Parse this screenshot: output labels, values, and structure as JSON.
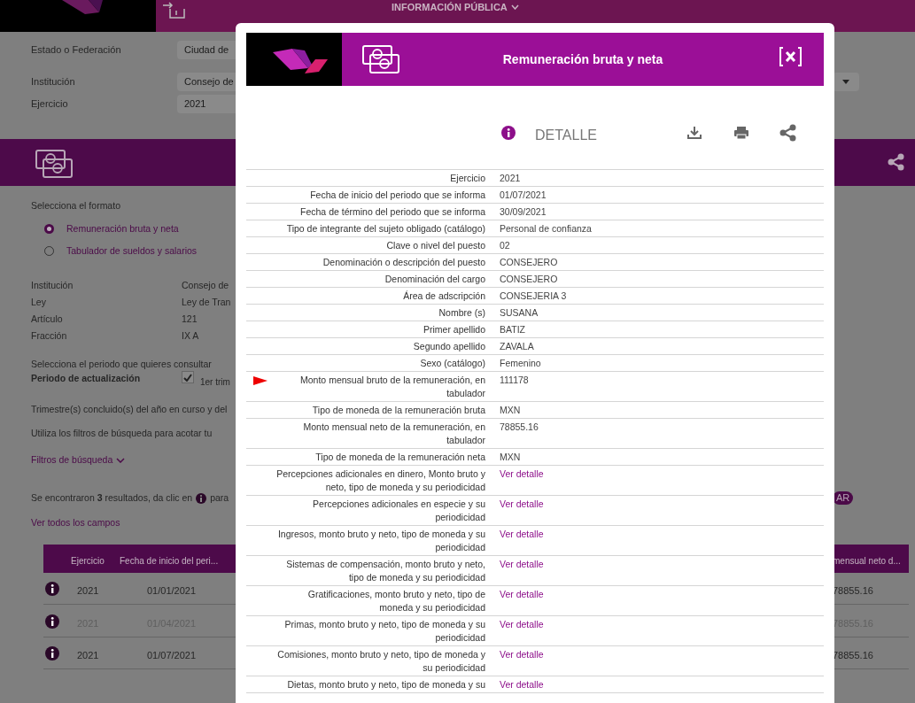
{
  "topbar": {
    "title": "INFORMACIÓN PÚBLICA"
  },
  "filters": [
    {
      "label": "Estado o Federación",
      "value": "Ciudad de"
    },
    {
      "label": "Institución",
      "value": "Consejo de"
    },
    {
      "label": "Ejercicio",
      "value": "2021"
    }
  ],
  "format": {
    "heading": "Selecciona el formato",
    "options": [
      {
        "label": "Remuneración bruta y neta",
        "selected": true
      },
      {
        "label": "Tabulador de sueldos y salarios",
        "selected": false
      }
    ]
  },
  "info": [
    {
      "label": "Institución",
      "value": "Consejo de"
    },
    {
      "label": "Ley",
      "value": "Ley de Tran"
    },
    {
      "label": "Artículo",
      "value": "121"
    },
    {
      "label": "Fracción",
      "value": "IX A"
    }
  ],
  "period": {
    "heading": "Selecciona el periodo que quieres consultar",
    "label": "Periodo de actualización",
    "option": {
      "label": "1er trim",
      "checked": true
    }
  },
  "notes": [
    "Trimestre(s) concluido(s) del año en curso y del",
    "Utiliza los filtros de búsqueda para acotar tu"
  ],
  "filters_link": "Filtros de búsqueda",
  "results": {
    "before": "Se encontraron **3** resultados, da clic en",
    "after": "para",
    "badge": "AR"
  },
  "all_fields_link": "Ver todos los campos",
  "table": {
    "columns": [
      "Ejercicio",
      "Fecha de inicio del peri...",
      "mensual neto d..."
    ],
    "rows": [
      {
        "cells": [
          "2021",
          "01/01/2021",
          "78855.16"
        ],
        "muted": false
      },
      {
        "cells": [
          "2021",
          "01/04/2021",
          "78855.16"
        ],
        "muted": true
      },
      {
        "cells": [
          "2021",
          "01/07/2021",
          "78855.16"
        ],
        "muted": false
      }
    ]
  },
  "modal": {
    "title": "Remuneración bruta y neta",
    "toolbar_title": "DETALLE",
    "fields": [
      {
        "label": "Ejercicio",
        "value": "2021",
        "kind": "text",
        "marked": false
      },
      {
        "label": "Fecha de inicio del periodo que se informa",
        "value": "01/07/2021",
        "kind": "text",
        "marked": false
      },
      {
        "label": "Fecha de término del periodo que se informa",
        "value": "30/09/2021",
        "kind": "text",
        "marked": false
      },
      {
        "label": "Tipo de integrante del sujeto obligado (catálogo)",
        "value": "Personal de confianza",
        "kind": "text",
        "marked": false
      },
      {
        "label": "Clave o nivel del puesto",
        "value": "02",
        "kind": "text",
        "marked": false
      },
      {
        "label": "Denominación o descripción del puesto",
        "value": "CONSEJERO",
        "kind": "text",
        "marked": false
      },
      {
        "label": "Denominación del cargo",
        "value": "CONSEJERO",
        "kind": "text",
        "marked": false
      },
      {
        "label": "Área de adscripción",
        "value": "CONSEJERIA 3",
        "kind": "text",
        "marked": false
      },
      {
        "label": "Nombre (s)",
        "value": "SUSANA",
        "kind": "text",
        "marked": false
      },
      {
        "label": "Primer apellido",
        "value": "BATIZ",
        "kind": "text",
        "marked": false
      },
      {
        "label": "Segundo apellido",
        "value": "ZAVALA",
        "kind": "text",
        "marked": false
      },
      {
        "label": "Sexo (catálogo)",
        "value": "Femenino",
        "kind": "text",
        "marked": false
      },
      {
        "label": "Monto mensual bruto de la remuneración, en tabulador",
        "value": "111178",
        "kind": "text",
        "marked": true
      },
      {
        "label": "Tipo de moneda de la remuneración bruta",
        "value": "MXN",
        "kind": "text",
        "marked": false
      },
      {
        "label": "Monto mensual neto de la remuneración, en tabulador",
        "value": "78855.16",
        "kind": "text",
        "marked": false
      },
      {
        "label": "Tipo de moneda de la remuneración neta",
        "value": "MXN",
        "kind": "text",
        "marked": false
      },
      {
        "label": "Percepciones adicionales en dinero, Monto bruto y neto, tipo de moneda y su periodicidad",
        "value": "Ver detalle",
        "kind": "link",
        "marked": false
      },
      {
        "label": "Percepciones adicionales en especie y su periodicidad",
        "value": "Ver detalle",
        "kind": "link",
        "marked": false
      },
      {
        "label": "Ingresos, monto bruto y neto, tipo de moneda y su periodicidad",
        "value": "Ver detalle",
        "kind": "link",
        "marked": false
      },
      {
        "label": "Sistemas de compensación, monto bruto y neto, tipo de moneda y su periodicidad",
        "value": "Ver detalle",
        "kind": "link",
        "marked": false
      },
      {
        "label": "Gratificaciones, monto bruto y neto, tipo de moneda y su periodicidad",
        "value": "Ver detalle",
        "kind": "link",
        "marked": false
      },
      {
        "label": "Primas, monto bruto y neto, tipo de moneda y su periodicidad",
        "value": "Ver detalle",
        "kind": "link",
        "marked": false
      },
      {
        "label": "Comisiones, monto bruto y neto, tipo de moneda y su periodicidad",
        "value": "Ver detalle",
        "kind": "link",
        "marked": false
      },
      {
        "label": "Dietas, monto bruto y neto, tipo de moneda y su",
        "value": "Ver detalle",
        "kind": "link",
        "marked": false
      }
    ]
  }
}
